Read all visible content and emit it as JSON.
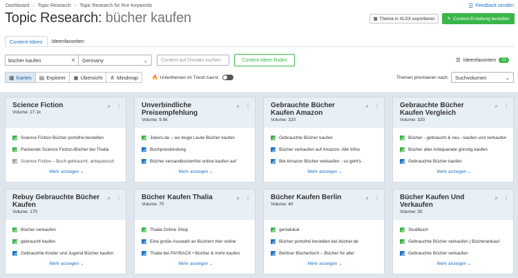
{
  "breadcrumb": [
    "Dashboard",
    "Topic Research",
    "Topic Research für Ihre Keywords"
  ],
  "feedback": "Feedback senden",
  "title": {
    "prefix": "Topic Research:",
    "keyword": "bücher kaufen"
  },
  "buttons": {
    "export": "Thema in XLSX exportieren",
    "create": "Content-Erstellung bestellen"
  },
  "tabs": [
    {
      "label": "Content-Ideen",
      "active": true
    },
    {
      "label": "Ideenfavoriten",
      "active": false
    }
  ],
  "search": {
    "keyword": "bücher kaufen",
    "country": "Germany",
    "domain_placeholder": "Content auf Domain suchen",
    "find_button": "Content-Ideen finden"
  },
  "favorites": {
    "label": "Ideenfavoriten",
    "count": "21"
  },
  "views": [
    {
      "label": "Karten",
      "active": true
    },
    {
      "label": "Explorer"
    },
    {
      "label": "Übersicht"
    },
    {
      "label": "Mindmap"
    }
  ],
  "trend_label": "Unterthemen im Trend zuerst",
  "priority": {
    "label": "Themen priorisieren nach:",
    "value": "Suchvolumen"
  },
  "more_label": "Mehr anzeigen",
  "cards": [
    {
      "title": "Science Fiction",
      "volume": "Volume: 27.1k",
      "items": [
        {
          "icon": "green",
          "text": "Science Fiction Bücher portofrei bestellen"
        },
        {
          "icon": "green",
          "text": "Packende Science Fiction-Bücher bei Thalia"
        },
        {
          "icon": "gray",
          "text": "Science Fiction – Buch gebraucht, antiquarisch"
        }
      ]
    },
    {
      "title": "Unverbindliche Preisempfehlung",
      "volume": "Volume: 9.9k",
      "items": [
        {
          "icon": "green",
          "text": "Jokers.de – wo kluge Leute Bücher kaufen"
        },
        {
          "icon": "blue",
          "text": "Buchpreisbindung"
        },
        {
          "icon": "blue",
          "text": "Bücher versandkostenfrei online kaufen auf"
        }
      ]
    },
    {
      "title": "Gebrauchte Bücher Kaufen Amazon",
      "volume": "Volume: 320",
      "items": [
        {
          "icon": "green",
          "text": "Gebrauchte Bücher kaufen"
        },
        {
          "icon": "blue",
          "text": "Bücher verkaufen auf Amazon: Alle Infos"
        },
        {
          "icon": "blue",
          "text": "Bei Amazon Bücher verkaufen - so geht's"
        }
      ]
    },
    {
      "title": "Gebrauchte Bücher Kaufen Vergleich",
      "volume": "Volume: 320",
      "items": [
        {
          "icon": "green",
          "text": "Bücher - gebraucht & neu - kaufen und verkaufen"
        },
        {
          "icon": "green",
          "text": "Bücher aller Antiquariate günstig kaufen"
        },
        {
          "icon": "blue",
          "text": "Gebrauchte Bücher kaufen"
        }
      ]
    },
    {
      "title": "Rebuy Gebrauchte Bücher Kaufen",
      "volume": "Volume: 170",
      "items": [
        {
          "icon": "green",
          "text": "Bücher verkaufen"
        },
        {
          "icon": "green",
          "text": "gebraucht kaufen"
        },
        {
          "icon": "blue",
          "text": "Gebrauchte Kinder und Jugend Bücher kaufen"
        }
      ]
    },
    {
      "title": "Bücher Kaufen Thalia",
      "volume": "Volume: 70",
      "items": [
        {
          "icon": "green",
          "text": "Thalia Online Shop"
        },
        {
          "icon": "blue",
          "text": "Eine große Auswahl an Büchern hier online"
        },
        {
          "icon": "blue",
          "text": "Thalia bei PAYBACK • Bücher & mehr kaufen"
        }
      ]
    },
    {
      "title": "Bücher Kaufen Berlin",
      "volume": "Volume: 40",
      "items": [
        {
          "icon": "green",
          "text": "genialokal"
        },
        {
          "icon": "blue",
          "text": "Bücher portofrei bestellen bei bücher.de"
        },
        {
          "icon": "blue",
          "text": "Berliner Büchertisch – Bücher für alle!"
        }
      ]
    },
    {
      "title": "Bücher Kaufen Und Verkaufen",
      "volume": "Volume: 30",
      "items": [
        {
          "icon": "green",
          "text": "Studibuch"
        },
        {
          "icon": "green",
          "text": "Gebrauchte Bücher verkaufen | Bücherankauf"
        },
        {
          "icon": "blue",
          "text": "Gebrauchte Bücher verkaufen"
        }
      ]
    }
  ]
}
